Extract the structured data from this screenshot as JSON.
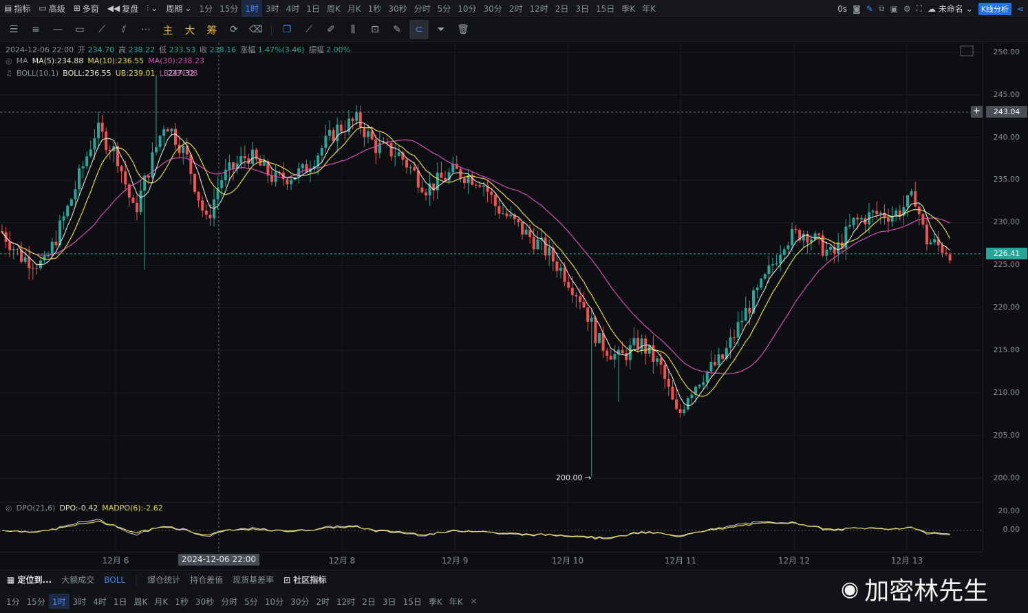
{
  "topbar": {
    "indicators": "指标",
    "advanced": "高级",
    "multi_window": "多窗",
    "replay": "复盘",
    "period": "周期",
    "periods": [
      "1分",
      "15分",
      "1时",
      "3时",
      "4时",
      "1日",
      "周K",
      "月K",
      "1秒",
      "30秒",
      "分时",
      "5分",
      "10分",
      "30分",
      "2时",
      "12时",
      "2日",
      "3日",
      "15日",
      "季K",
      "年K"
    ],
    "active_period": "1时",
    "countdown": "0s",
    "layout_name": "未命名",
    "kline_analysis": "K线分析"
  },
  "toolbar": {
    "gold_tools": [
      "主",
      "大",
      "筹"
    ]
  },
  "legend": {
    "date": "2024-12-06 22:00",
    "open_label": "开",
    "open": "234.70",
    "high_label": "高",
    "high": "238.22",
    "low_label": "低",
    "low": "233.53",
    "close_label": "收",
    "close": "238.16",
    "change_label": "涨幅",
    "change": "1.47%(3.46)",
    "amp_label": "振幅",
    "amplitude": "2.00%",
    "ma_name": "MA",
    "ma5": "MA(5):234.88",
    "ma10": "MA(10):236.55",
    "ma30": "MA(30):238.23",
    "boll_name": "BOLL(10,1)",
    "boll": "BOLL:236.55",
    "ub": "UB:239.01",
    "lb": "LB:234.08",
    "dpo_name": "DPO(21,6)",
    "dpo": "DPO:-0.42",
    "madpo": "MADPO(6):-2.62"
  },
  "price_axis": {
    "labels": [
      "250.00",
      "245.00",
      "240.00",
      "235.00",
      "230.00",
      "225.00",
      "220.00",
      "215.00",
      "210.00",
      "205.00",
      "200.00"
    ],
    "cursor_price": "243.04",
    "last_price": "226.41",
    "dpo_labels": [
      "20.00",
      "0.00"
    ]
  },
  "annotations": {
    "high_marker": "247.32",
    "low_marker": "200.00 →"
  },
  "time_axis": {
    "labels": [
      "12月 6",
      "12月 8",
      "12月 9",
      "12月 10",
      "12月 11",
      "12月 12",
      "12月 13"
    ],
    "cursor_time": "2024-12-06 22:00"
  },
  "bottom": {
    "locate": "定位到...",
    "big_trade": "大额成交",
    "boll": "BOLL",
    "liquidation": "爆仓统计",
    "position_diff": "持仓差值",
    "basis": "现货基差率",
    "community": "社区指标",
    "periods": [
      "1分",
      "15分",
      "1时",
      "3时",
      "4时",
      "1日",
      "周K",
      "月K",
      "1秒",
      "30秒",
      "分时",
      "5分",
      "10分",
      "30分",
      "2时",
      "12时",
      "2日",
      "3日",
      "15日",
      "季K",
      "年K"
    ],
    "active_period": "1时"
  },
  "watermark": "加密林先生",
  "colors": {
    "up": "#26a69a",
    "down": "#ef5350",
    "ma5": "#e8e6d0",
    "ma10": "#e8d84a",
    "ma30": "#d64fb6",
    "accent": "#3d8bfd"
  }
}
